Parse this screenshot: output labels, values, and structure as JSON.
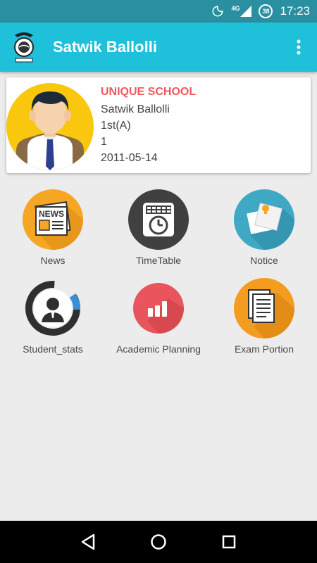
{
  "status_bar": {
    "network": "4G",
    "battery": "38",
    "time": "17:23"
  },
  "app_bar": {
    "title": "Satwik Ballolli"
  },
  "profile": {
    "school": "UNIQUE SCHOOL",
    "name": "Satwik Ballolli",
    "class": "1st(A)",
    "roll": "1",
    "dob": "2011-05-14"
  },
  "menu": [
    {
      "label": "News",
      "icon": "news-icon",
      "color": "#f5a623"
    },
    {
      "label": "TimeTable",
      "icon": "timetable-icon",
      "color": "#404040"
    },
    {
      "label": "Notice",
      "icon": "notice-icon",
      "color": "#3fa9c4"
    },
    {
      "label": "Student_stats",
      "icon": "student-stats-icon",
      "color": "#2f2f2f"
    },
    {
      "label": "Academic Planning",
      "icon": "academic-planning-icon",
      "color": "#e8555c"
    },
    {
      "label": "Exam Portion",
      "icon": "exam-portion-icon",
      "color": "#f39c1f"
    }
  ],
  "colors": {
    "status_bar": "#2a8fa1",
    "app_bar": "#1fc0d9",
    "school_name": "#f0565e",
    "background": "#ececec"
  }
}
